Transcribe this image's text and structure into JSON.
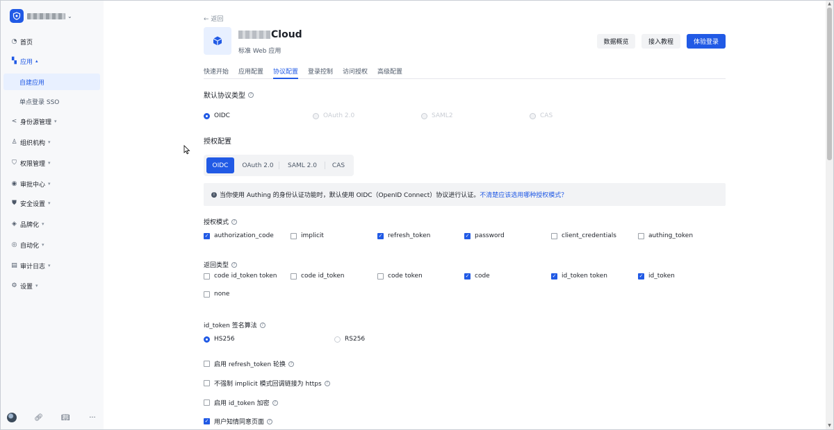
{
  "sidebar": {
    "items": [
      {
        "label": "首页",
        "icon": "pie-chart-icon"
      },
      {
        "label": "应用",
        "icon": "apps-icon",
        "expanded": true
      },
      {
        "label": "身份源管理",
        "icon": "share-icon"
      },
      {
        "label": "组织机构",
        "icon": "org-icon"
      },
      {
        "label": "权限管理",
        "icon": "shield-icon"
      },
      {
        "label": "审批中心",
        "icon": "approval-icon"
      },
      {
        "label": "安全设置",
        "icon": "security-icon"
      },
      {
        "label": "品牌化",
        "icon": "brand-icon"
      },
      {
        "label": "自动化",
        "icon": "automation-icon"
      },
      {
        "label": "审计日志",
        "icon": "audit-log-icon"
      },
      {
        "label": "设置",
        "icon": "gear-icon"
      }
    ],
    "sub_items": [
      {
        "label": "自建应用",
        "active": true
      },
      {
        "label": "单点登录 SSO",
        "active": false
      }
    ]
  },
  "header": {
    "back": "← 返回",
    "app_name_suffix": "Cloud",
    "app_subtitle": "标准 Web 应用",
    "buttons": {
      "overview": "数据概览",
      "tutorial": "接入教程",
      "try_login": "体验登录"
    }
  },
  "tabs": [
    "快速开始",
    "应用配置",
    "协议配置",
    "登录控制",
    "访问授权",
    "高级配置"
  ],
  "active_tab": "协议配置",
  "default_protocol": {
    "title": "默认协议类型",
    "options": [
      "OIDC",
      "OAuth 2.0",
      "SAML2",
      "CAS"
    ],
    "selected": "OIDC"
  },
  "auth_config": {
    "title": "授权配置",
    "segments": [
      "OIDC",
      "OAuth 2.0",
      "SAML 2.0",
      "CAS"
    ],
    "active_segment": "OIDC",
    "info_text": "当你使用 Authing 的身份认证功能时，默认使用 OIDC（OpenID Connect）协议进行认证。",
    "info_link": "不清楚应该选用哪种授权模式？"
  },
  "grant_types": {
    "title": "授权模式",
    "options": [
      {
        "label": "authorization_code",
        "checked": true
      },
      {
        "label": "implicit",
        "checked": false
      },
      {
        "label": "refresh_token",
        "checked": true
      },
      {
        "label": "password",
        "checked": true
      },
      {
        "label": "client_credentials",
        "checked": false
      },
      {
        "label": "authing_token",
        "checked": false
      }
    ]
  },
  "response_types": {
    "title": "返回类型",
    "options": [
      {
        "label": "code id_token token",
        "checked": false
      },
      {
        "label": "code id_token",
        "checked": false
      },
      {
        "label": "code token",
        "checked": false
      },
      {
        "label": "code",
        "checked": true
      },
      {
        "label": "id_token token",
        "checked": true
      },
      {
        "label": "id_token",
        "checked": true
      },
      {
        "label": "none",
        "checked": false
      }
    ]
  },
  "signing_alg": {
    "title": "id_token 签名算法",
    "options": [
      "HS256",
      "RS256"
    ],
    "selected": "HS256"
  },
  "toggles": [
    {
      "label": "启用 refresh_token 轮换",
      "checked": false
    },
    {
      "label": "不强制 implicit 模式回调链接为 https",
      "checked": false
    },
    {
      "label": "启用 id_token 加密",
      "checked": false
    },
    {
      "label": "用户知情同意页面",
      "checked": true
    }
  ],
  "colors": {
    "accent": "#215ae5",
    "sidebar_bg": "#f7f8fa",
    "active_bg": "#e8f0ff"
  }
}
